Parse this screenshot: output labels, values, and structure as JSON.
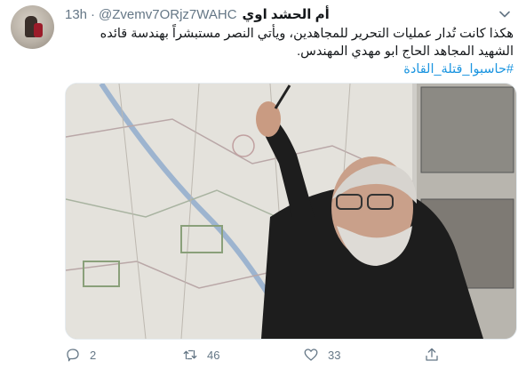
{
  "tweet": {
    "display_name": "أم الحشد اوي",
    "handle": "@Zvemv7ORjz7WAHC",
    "separator": "·",
    "time": "13h",
    "text": "هكذا كانت تُدار عمليات التحرير للمجاهدين، ويأتي النصر مستبشراً بهندسة قائده الشهيد المجاهد الحاج ابو مهدي المهندس.",
    "hashtag": "#حاسبوا_قتلة_القادة"
  },
  "actions": {
    "replies": "2",
    "retweets": "46",
    "likes": "33"
  },
  "icons": {
    "menu": "chevron-down-icon",
    "reply": "reply-icon",
    "retweet": "retweet-icon",
    "like": "heart-icon",
    "share": "share-icon"
  },
  "colors": {
    "text": "#14171a",
    "muted": "#657786",
    "link": "#1b95e0"
  }
}
